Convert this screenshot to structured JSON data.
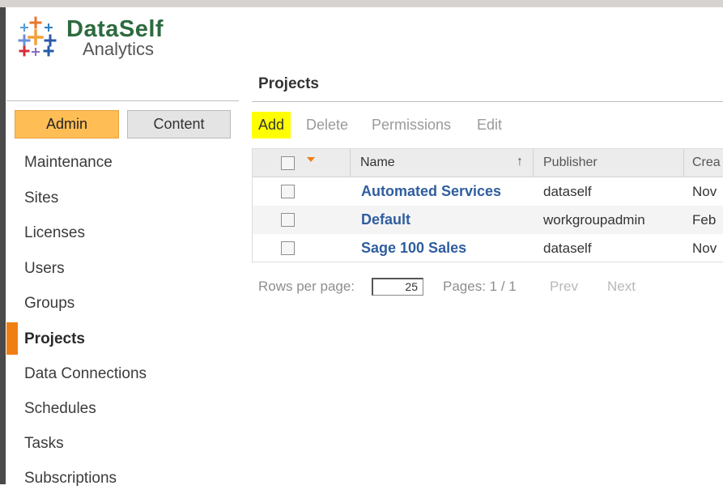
{
  "logo": {
    "title": "DataSelf",
    "subtitle": "Analytics",
    "icon": "tableau-plus-cluster-icon"
  },
  "tabs": {
    "admin": "Admin",
    "content": "Content"
  },
  "nav": {
    "items": [
      {
        "label": "Maintenance"
      },
      {
        "label": "Sites"
      },
      {
        "label": "Licenses"
      },
      {
        "label": "Users"
      },
      {
        "label": "Groups"
      },
      {
        "label": "Projects",
        "active": true
      },
      {
        "label": "Data Connections"
      },
      {
        "label": "Schedules"
      },
      {
        "label": "Tasks"
      },
      {
        "label": "Subscriptions"
      }
    ]
  },
  "page": {
    "title": "Projects"
  },
  "toolbar": {
    "add": "Add",
    "delete": "Delete",
    "permissions": "Permissions",
    "edit": "Edit"
  },
  "grid": {
    "columns": {
      "name": "Name",
      "publisher": "Publisher",
      "created": "Crea"
    },
    "sort_indicator": "↑",
    "rows": [
      {
        "name": "Automated Services",
        "publisher": "dataself",
        "created": "Nov"
      },
      {
        "name": "Default",
        "publisher": "workgroupadmin",
        "created": "Feb"
      },
      {
        "name": "Sage 100 Sales",
        "publisher": "dataself",
        "created": "Nov"
      }
    ]
  },
  "pager": {
    "rows_label": "Rows per page:",
    "rows_value": "25",
    "pages": "Pages: 1 / 1",
    "prev": "Prev",
    "next": "Next"
  },
  "colors": {
    "accent_orange": "#f07f13",
    "admin_tab": "#ffbe55",
    "add_highlight": "#ffff00",
    "link_blue": "#2f5e9f",
    "logo_green": "#2d6a3f"
  }
}
